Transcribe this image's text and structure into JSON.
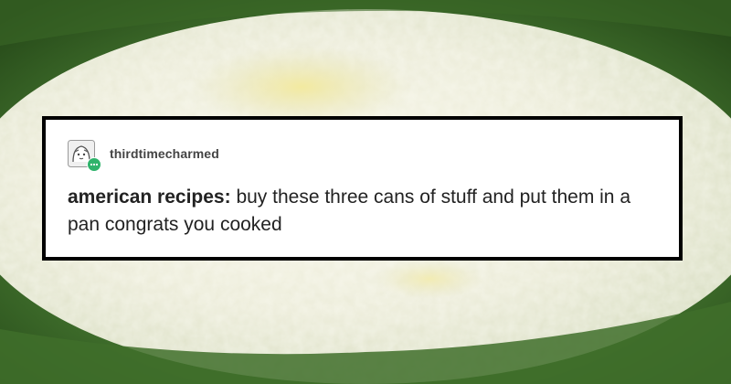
{
  "post": {
    "username": "thirdtimecharmed",
    "lead": "american recipes:",
    "text": " buy these three cans of stuff and put them in a pan congrats you cooked"
  },
  "icons": {
    "avatar": "user-avatar-icon",
    "badge": "chat-badge-icon"
  },
  "colors": {
    "card_border": "#000000",
    "card_background": "#ffffff",
    "badge": "#2fb36b"
  }
}
